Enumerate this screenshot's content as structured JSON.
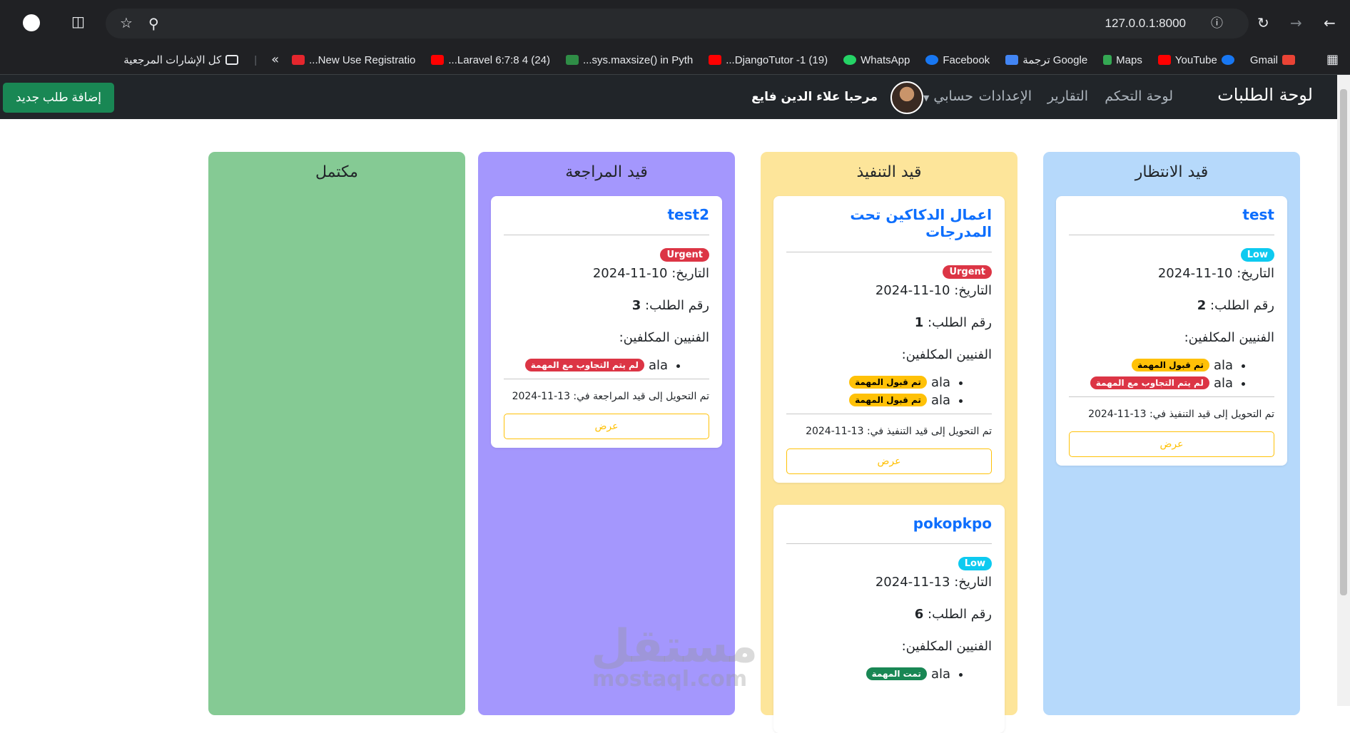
{
  "browser": {
    "url": "127.0.0.1:8000"
  },
  "bookmarks": [
    "Gmail",
    "YouTube",
    "Maps",
    "Google ترجمة",
    "Facebook",
    "WhatsApp",
    "(19) 1- DjangoTutor...",
    "sys.maxsize() in Pyth...",
    "(24) 4 Laravel 6:7:8...",
    "New Use Registratio...",
    "كل الإشارات المرجعية"
  ],
  "nav": {
    "brand": "لوحة الطلبات",
    "links": [
      "لوحة التحكم",
      "التقارير",
      "الإعدادات",
      "حسابي"
    ],
    "welcome": "مرحبا علاء الدين فايع",
    "add_button": "إضافة طلب جديد"
  },
  "columns": [
    {
      "title": "قيد الانتظار",
      "color": "#b6d9fb",
      "cards": [
        {
          "title": "test",
          "priority": "Low",
          "priority_color": "#0dcaf0",
          "date_label": "التاريخ:",
          "date": "10-11-2024",
          "num_label": "رقم الطلب:",
          "num": "2",
          "tech_label": "الفنيين المكلفين:",
          "techs": [
            {
              "name": "ala",
              "status": "تم قبول المهمة",
              "color": "#ffc107",
              "text": "#000"
            },
            {
              "name": "ala",
              "status": "لم يتم التجاوب مع المهمة",
              "color": "#dc3545",
              "text": "#fff"
            }
          ],
          "transfer": "تم التحويل إلى قيد التنفيذ في: 13-11-2024",
          "view": "عرض"
        }
      ]
    },
    {
      "title": "قيد التنفيذ",
      "color": "#fde59a",
      "cards": [
        {
          "title": "اعمال الدكاكين تحت المدرجات",
          "priority": "Urgent",
          "priority_color": "#dc3545",
          "date_label": "التاريخ:",
          "date": "10-11-2024",
          "num_label": "رقم الطلب:",
          "num": "1",
          "tech_label": "الفنيين المكلفين:",
          "techs": [
            {
              "name": "ala",
              "status": "تم قبول المهمة",
              "color": "#ffc107",
              "text": "#000"
            },
            {
              "name": "ala",
              "status": "تم قبول المهمة",
              "color": "#ffc107",
              "text": "#000"
            }
          ],
          "transfer": "تم التحويل إلى قيد التنفيذ في: 13-11-2024",
          "view": "عرض"
        },
        {
          "title": "pokopkpo",
          "priority": "Low",
          "priority_color": "#0dcaf0",
          "date_label": "التاريخ:",
          "date": "13-11-2024",
          "num_label": "رقم الطلب:",
          "num": "6",
          "tech_label": "الفنيين المكلفين:",
          "techs": [
            {
              "name": "ala",
              "status": "تمت المهمة",
              "color": "#198754",
              "text": "#fff"
            }
          ]
        }
      ]
    },
    {
      "title": "قيد المراجعة",
      "color": "#a497fd",
      "cards": [
        {
          "title": "test2",
          "priority": "Urgent",
          "priority_color": "#dc3545",
          "date_label": "التاريخ:",
          "date": "10-11-2024",
          "num_label": "رقم الطلب:",
          "num": "3",
          "tech_label": "الفنيين المكلفين:",
          "techs": [
            {
              "name": "ala",
              "status": "لم يتم التجاوب مع المهمة",
              "color": "#dc3545",
              "text": "#fff"
            }
          ],
          "transfer": "تم التحويل إلى قيد المراجعة في: 13-11-2024",
          "view": "عرض"
        }
      ]
    },
    {
      "title": "مكتمل",
      "color": "#85ca94",
      "cards": []
    }
  ],
  "watermark": {
    "logo": "مستقل",
    "domain": "mostaql.com"
  }
}
